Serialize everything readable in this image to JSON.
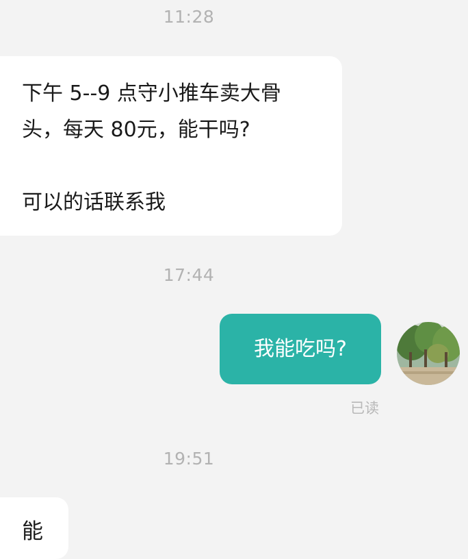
{
  "chat": {
    "timestamps": [
      "11:28",
      "17:44",
      "19:51"
    ],
    "messages": [
      {
        "direction": "incoming",
        "lines": [
          "下午 5--9 点守小推车卖大骨",
          "头，每天 80元，能干吗?"
        ],
        "lines2": [
          "可以的话联系我"
        ]
      },
      {
        "direction": "outgoing",
        "text": "我能吃吗?",
        "status": "已读",
        "avatar_icon": "tree-photo-avatar"
      },
      {
        "direction": "incoming",
        "text": "能"
      }
    ]
  },
  "colors": {
    "background": "#f3f3f3",
    "incoming_bubble": "#ffffff",
    "outgoing_bubble": "#2bb3a7",
    "timestamp_text": "#b2b2b2"
  }
}
